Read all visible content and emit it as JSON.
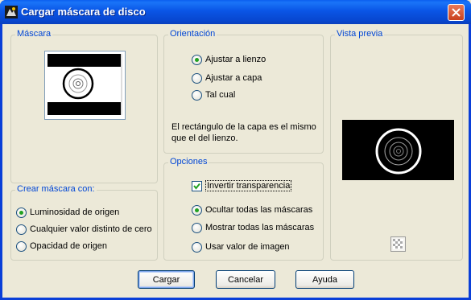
{
  "window": {
    "title": "Cargar máscara de disco",
    "close_label": "✕"
  },
  "mascara_group": {
    "title": "Máscara"
  },
  "crear_group": {
    "title": "Crear máscara con:",
    "options": [
      {
        "label": "Luminosidad de origen",
        "selected": true
      },
      {
        "label": "Cualquier valor distinto de cero",
        "selected": false
      },
      {
        "label": "Opacidad de origen",
        "selected": false
      }
    ]
  },
  "orientacion_group": {
    "title": "Orientación",
    "options": [
      {
        "label": "Ajustar a lienzo",
        "selected": true
      },
      {
        "label": "Ajustar a capa",
        "selected": false
      },
      {
        "label": "Tal cual",
        "selected": false
      }
    ],
    "info_text": "El rectángulo de la capa es el mismo que el del lienzo."
  },
  "opciones_group": {
    "title": "Opciones",
    "invert_label": "Invertir transparencia",
    "invert_checked": true,
    "options": [
      {
        "label": "Ocultar todas las máscaras",
        "selected": true
      },
      {
        "label": "Mostrar todas las máscaras",
        "selected": false
      },
      {
        "label": "Usar valor de imagen",
        "selected": false
      }
    ]
  },
  "preview_group": {
    "title": "Vista previa"
  },
  "buttons": {
    "ok": "Cargar",
    "cancel": "Cancelar",
    "help": "Ayuda"
  },
  "colors": {
    "accent": "#0046d5",
    "titlebar": "#0a55e6",
    "selected_dot": "#21a121"
  }
}
